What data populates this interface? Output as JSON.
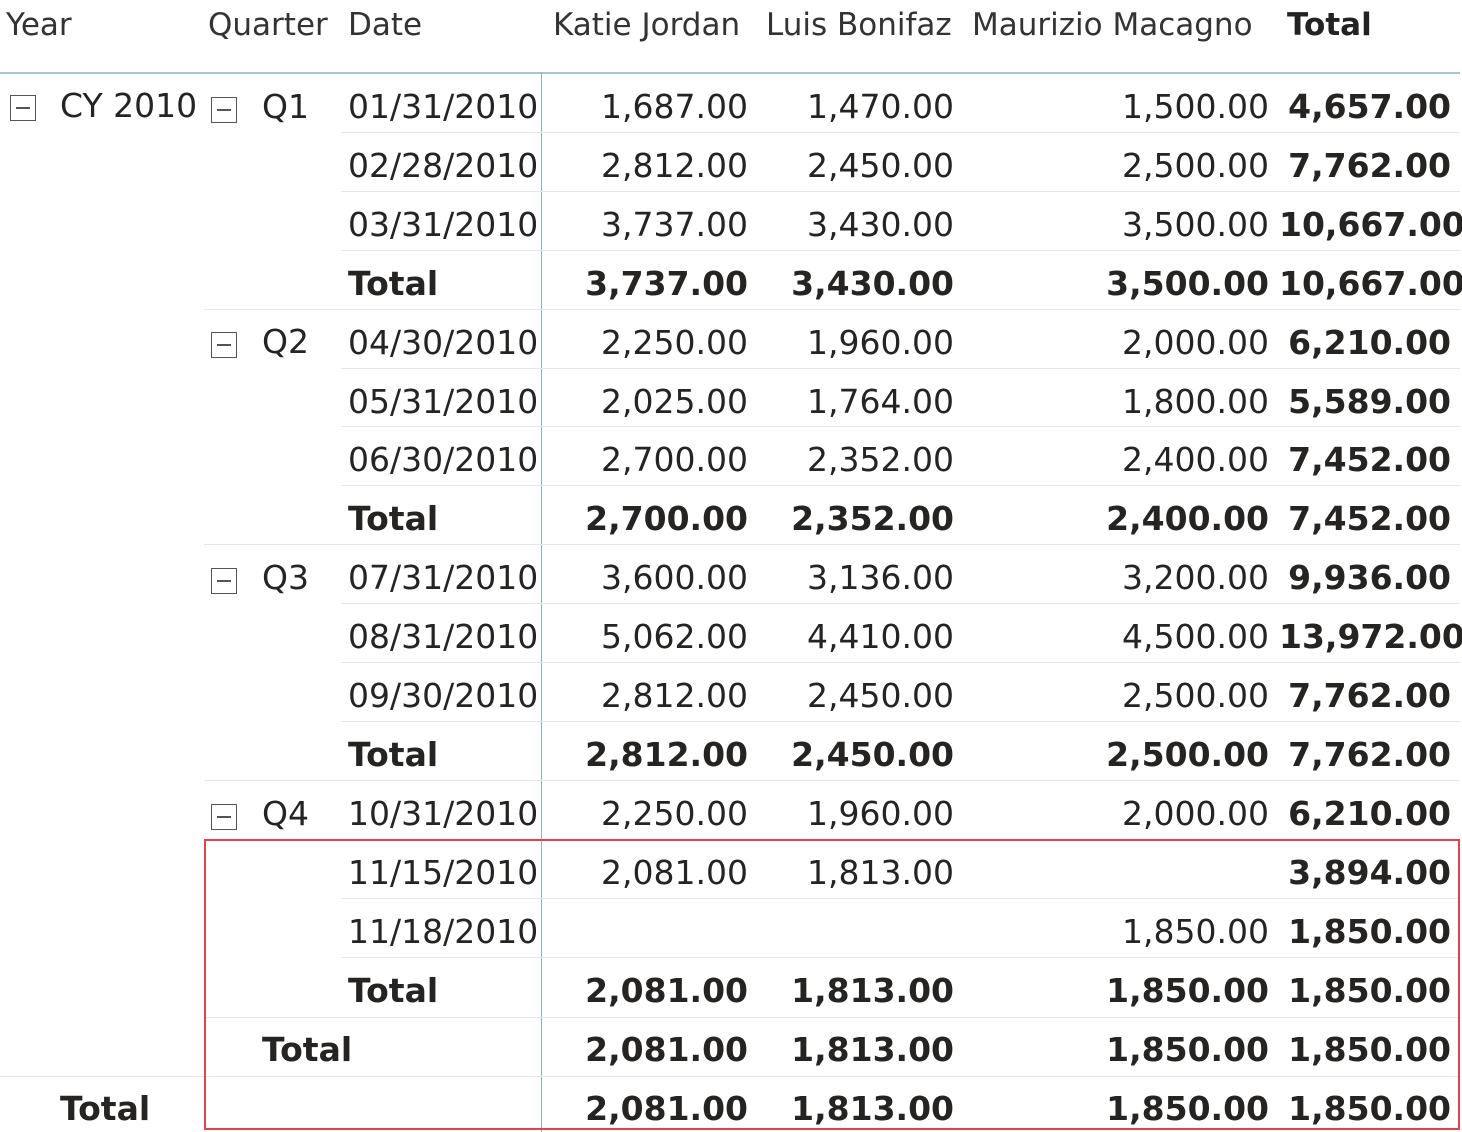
{
  "header": {
    "year": "Year",
    "quarter": "Quarter",
    "date": "Date",
    "c1": "Katie Jordan",
    "c2": "Luis Bonifaz",
    "c3": "Maurizio Macagno",
    "total": "Total"
  },
  "year_label": "CY 2010",
  "quarters": [
    "Q1",
    "Q2",
    "Q3",
    "Q4"
  ],
  "rows": [
    {
      "date": "01/31/2010",
      "c1": "1,687.00",
      "c2": "1,470.00",
      "c3": "1,500.00",
      "total": "4,657.00"
    },
    {
      "date": "02/28/2010",
      "c1": "2,812.00",
      "c2": "2,450.00",
      "c3": "2,500.00",
      "total": "7,762.00"
    },
    {
      "date": "03/31/2010",
      "c1": "3,737.00",
      "c2": "3,430.00",
      "c3": "3,500.00",
      "total": "10,667.00"
    },
    {
      "date": "Total",
      "c1": "3,737.00",
      "c2": "3,430.00",
      "c3": "3,500.00",
      "total": "10,667.00"
    },
    {
      "date": "04/30/2010",
      "c1": "2,250.00",
      "c2": "1,960.00",
      "c3": "2,000.00",
      "total": "6,210.00"
    },
    {
      "date": "05/31/2010",
      "c1": "2,025.00",
      "c2": "1,764.00",
      "c3": "1,800.00",
      "total": "5,589.00"
    },
    {
      "date": "06/30/2010",
      "c1": "2,700.00",
      "c2": "2,352.00",
      "c3": "2,400.00",
      "total": "7,452.00"
    },
    {
      "date": "Total",
      "c1": "2,700.00",
      "c2": "2,352.00",
      "c3": "2,400.00",
      "total": "7,452.00"
    },
    {
      "date": "07/31/2010",
      "c1": "3,600.00",
      "c2": "3,136.00",
      "c3": "3,200.00",
      "total": "9,936.00"
    },
    {
      "date": "08/31/2010",
      "c1": "5,062.00",
      "c2": "4,410.00",
      "c3": "4,500.00",
      "total": "13,972.00"
    },
    {
      "date": "09/30/2010",
      "c1": "2,812.00",
      "c2": "2,450.00",
      "c3": "2,500.00",
      "total": "7,762.00"
    },
    {
      "date": "Total",
      "c1": "2,812.00",
      "c2": "2,450.00",
      "c3": "2,500.00",
      "total": "7,762.00"
    },
    {
      "date": "10/31/2010",
      "c1": "2,250.00",
      "c2": "1,960.00",
      "c3": "2,000.00",
      "total": "6,210.00"
    },
    {
      "date": "11/15/2010",
      "c1": "2,081.00",
      "c2": "1,813.00",
      "c3": "",
      "total": "3,894.00"
    },
    {
      "date": "11/18/2010",
      "c1": "",
      "c2": "",
      "c3": "1,850.00",
      "total": "1,850.00"
    },
    {
      "date": "Total",
      "c1": "2,081.00",
      "c2": "1,813.00",
      "c3": "1,850.00",
      "total": "1,850.00"
    }
  ],
  "year_total": {
    "label": "Total",
    "c1": "2,081.00",
    "c2": "1,813.00",
    "c3": "1,850.00",
    "total": "1,850.00"
  },
  "grand_total": {
    "label": "Total",
    "c1": "2,081.00",
    "c2": "1,813.00",
    "c3": "1,850.00",
    "total": "1,850.00"
  },
  "colors": {
    "highlight": "#e0434e",
    "header_rule": "#a3c8c8",
    "row_rule": "#e6e6e6"
  }
}
